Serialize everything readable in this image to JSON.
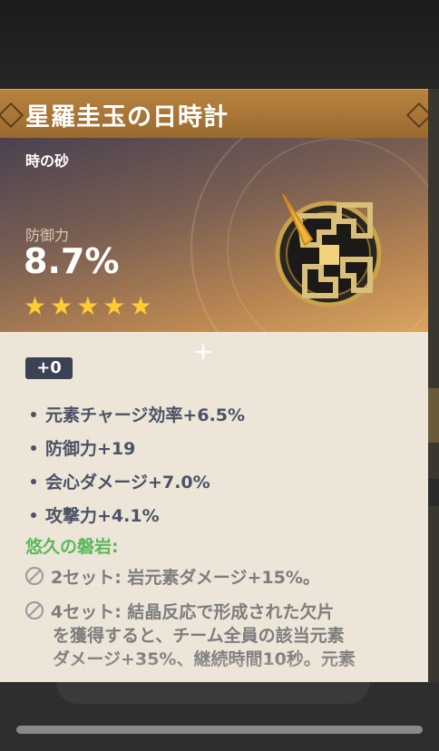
{
  "artifact": {
    "name": "星羅圭玉の日時計",
    "type": "時の砂",
    "main_stat": {
      "label": "防御力",
      "value": "8.7%"
    },
    "rarity": 5,
    "level": "+0",
    "substats": [
      "元素チャージ効率+6.5%",
      "防御力+19",
      "会心ダメージ+7.0%",
      "攻撃力+4.1%"
    ],
    "set": {
      "name": "悠久の磐岩:",
      "effect_2": "2セット: 岩元素ダメージ+15%。",
      "effect_4_lines": [
        "4セット: 結晶反応で形成された欠片",
        "を獲得すると、チーム全員の該当元素",
        "ダメージ+35%、継続時間10秒。元素"
      ]
    }
  },
  "colors": {
    "header": "#b8833e",
    "star": "#ffcc32",
    "set_name": "#5cb85c",
    "substat_text": "#4a5366",
    "body_bg": "#ece5d8"
  },
  "icons": {
    "artifact": "artifact-sands-icon",
    "star": "star-icon",
    "set_effect_inactive": "inactive-slash-icon"
  }
}
